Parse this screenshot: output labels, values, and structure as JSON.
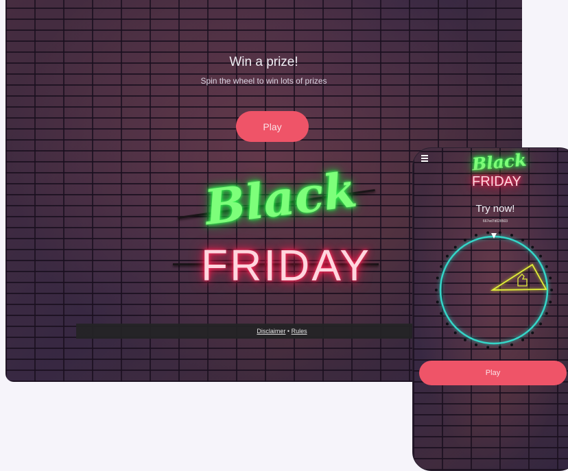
{
  "desktop": {
    "title": "Win a prize!",
    "subtitle": "Spin the wheel to win lots of prizes",
    "play_label": "Play",
    "neon_line1": "Black",
    "neon_line2": "FRIDAY",
    "footer": {
      "disclaimer_label": "Disclaimer",
      "separator": " • ",
      "rules_label": "Rules"
    }
  },
  "phone": {
    "neon_line1": "Black",
    "neon_line2": "FRIDAY",
    "heading": "Try now!",
    "code": "667ed7d028503",
    "play_label": "Play"
  },
  "colors": {
    "button": "#ef5468",
    "neon_green": "#7dff7a",
    "neon_pink": "#ff3060",
    "wheel_ring": "#35d6c8",
    "wheel_slice": "#e3f03a"
  },
  "icons": [
    "menu-icon",
    "wheel-pointer-icon",
    "thumbs-up-icon"
  ]
}
